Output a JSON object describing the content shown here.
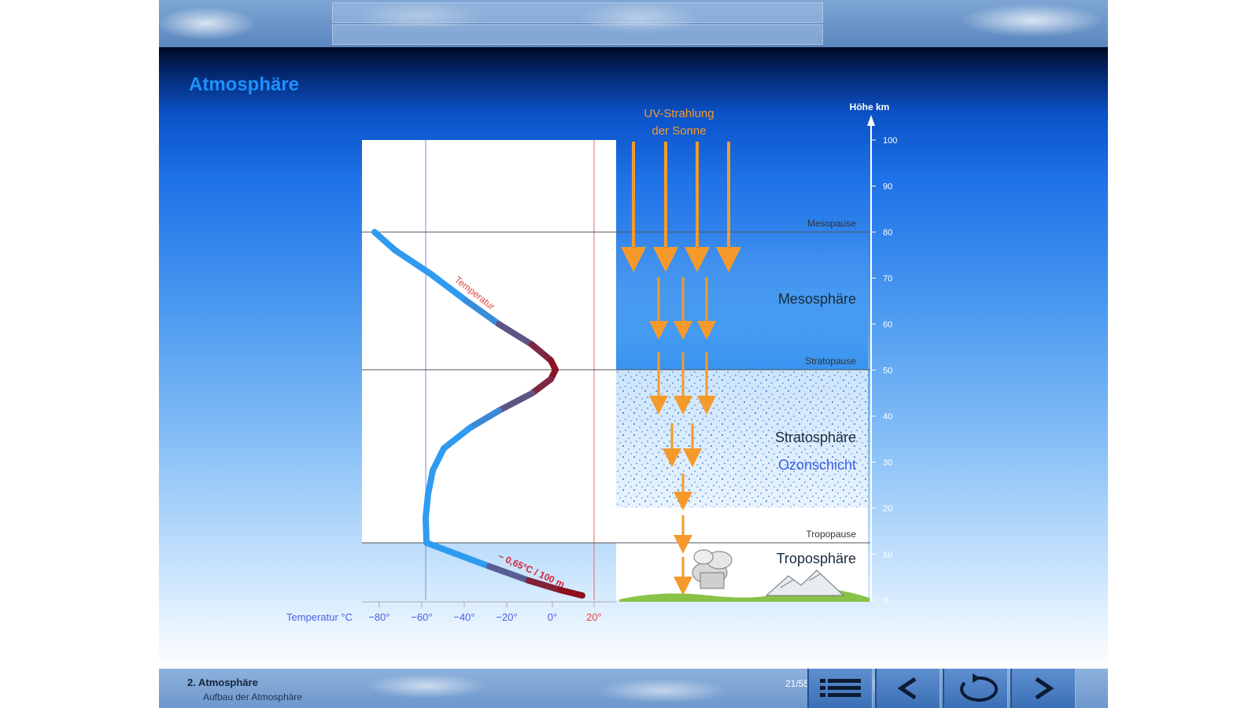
{
  "slide": {
    "title": "Atmosphäre"
  },
  "diagram": {
    "uv_label_line1": "UV-Strahlung",
    "uv_label_line2": "der Sonne",
    "height_axis_label": "Höhe km",
    "height_ticks": [
      "100",
      "90",
      "80",
      "70",
      "60",
      "50",
      "40",
      "30",
      "20",
      "10",
      "0"
    ],
    "temp_axis_label": "Temperatur °C",
    "temp_ticks": [
      "−80°",
      "−60°",
      "−40°",
      "−20°",
      "0°",
      "20°"
    ],
    "boundaries": {
      "mesopause": "Mesopause",
      "stratopause": "Stratopause",
      "tropopause": "Tropopause"
    },
    "layers": {
      "mesosphere": "Mesosphäre",
      "stratosphere": "Stratosphäre",
      "ozone": "Ozonschicht",
      "troposphere": "Troposphäre"
    },
    "curve_label": "Temperatur",
    "lapse_rate": "− 0,65°C / 100 m",
    "colors": {
      "uv_arrows": "#f59a2a",
      "curve_cold": "#2f9bf0",
      "curve_warm": "#8e0f1d",
      "title": "#1e90ff"
    }
  },
  "footer": {
    "chapter": "2. Atmosphäre",
    "subtitle": "Aufbau der Atmosphäre",
    "page": "21/55",
    "buttons": {
      "menu": "menu-icon",
      "back": "chevron-left-icon",
      "reload": "reload-icon",
      "next": "chevron-right-icon"
    }
  }
}
